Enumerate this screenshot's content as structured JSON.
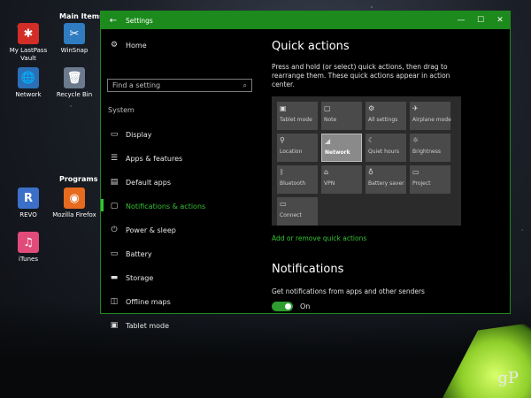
{
  "desktop": {
    "main_items_label": "Main Items",
    "programs_label": "Programs",
    "icons": [
      {
        "id": "lastpass",
        "label": "My LastPass Vault",
        "glyph": "✱",
        "color": "#d32d27"
      },
      {
        "id": "winsnap",
        "label": "WinSnap",
        "glyph": "✂",
        "color": "#2f7cc1"
      },
      {
        "id": "network",
        "label": "Network",
        "glyph": "🌐",
        "color": "#2b6fb7"
      },
      {
        "id": "recyclebin",
        "label": "Recycle Bin",
        "glyph": "🗑",
        "color": "#6b7a8c"
      },
      {
        "id": "revo",
        "label": "REVO",
        "glyph": "R",
        "color": "#3c70c8"
      },
      {
        "id": "firefox",
        "label": "Mozilla Firefox",
        "glyph": "◉",
        "color": "#e66a1f"
      },
      {
        "id": "itunes",
        "label": "iTunes",
        "glyph": "♫",
        "color": "#e04b7a"
      }
    ],
    "watermark": "gP"
  },
  "window": {
    "title": "Settings",
    "back_glyph": "←",
    "minimize_glyph": "—",
    "maximize_glyph": "☐",
    "close_glyph": "✕"
  },
  "sidebar": {
    "home_label": "Home",
    "home_icon": "⚙",
    "search_placeholder": "Find a setting",
    "search_icon": "⌕",
    "section_title": "System",
    "items": [
      {
        "label": "Display",
        "icon": "▭",
        "active": false
      },
      {
        "label": "Apps & features",
        "icon": "☰",
        "active": false
      },
      {
        "label": "Default apps",
        "icon": "▤",
        "active": false
      },
      {
        "label": "Notifications & actions",
        "icon": "▢",
        "active": true
      },
      {
        "label": "Power & sleep",
        "icon": "⏻",
        "active": false
      },
      {
        "label": "Battery",
        "icon": "▭",
        "active": false
      },
      {
        "label": "Storage",
        "icon": "▬",
        "active": false
      },
      {
        "label": "Offline maps",
        "icon": "◫",
        "active": false
      },
      {
        "label": "Tablet mode",
        "icon": "▣",
        "active": false
      }
    ]
  },
  "main": {
    "quick_actions_title": "Quick actions",
    "quick_actions_desc": "Press and hold (or select) quick actions, then drag to rearrange them. These quick actions appear in action center.",
    "tiles": [
      {
        "label": "Tablet mode",
        "icon": "▣"
      },
      {
        "label": "Note",
        "icon": "▢"
      },
      {
        "label": "All settings",
        "icon": "⚙"
      },
      {
        "label": "Airplane mode",
        "icon": "✈"
      },
      {
        "label": "Location",
        "icon": "⚲"
      },
      {
        "label": "Network",
        "icon": "◢",
        "selected": true
      },
      {
        "label": "Quiet hours",
        "icon": "☾"
      },
      {
        "label": "Brightness",
        "icon": "☼"
      },
      {
        "label": "Bluetooth",
        "icon": "ᛒ"
      },
      {
        "label": "VPN",
        "icon": "⌂"
      },
      {
        "label": "Battery saver",
        "icon": "♁"
      },
      {
        "label": "Project",
        "icon": "▭"
      },
      {
        "label": "Connect",
        "icon": "▭"
      }
    ],
    "add_remove_link": "Add or remove quick actions",
    "notifications_title": "Notifications",
    "notifications_desc": "Get notifications from apps and other senders",
    "toggle_state": "On"
  }
}
